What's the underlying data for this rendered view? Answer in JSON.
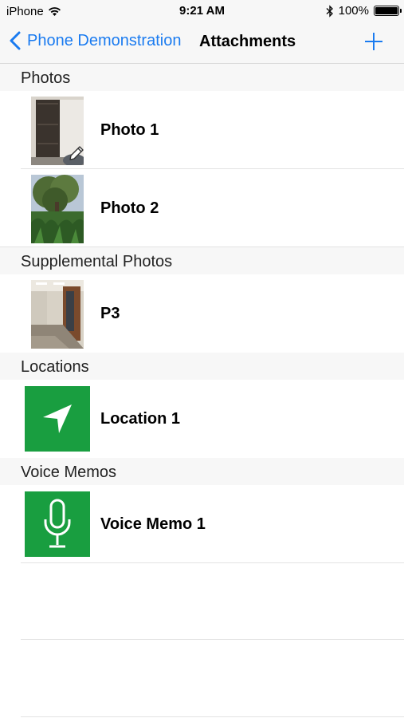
{
  "status_bar": {
    "carrier": "iPhone",
    "time": "9:21 AM",
    "battery": "100%",
    "battery_level": 1.0
  },
  "nav": {
    "back_label": "Phone Demonstration",
    "title": "Attachments",
    "accent_color": "#1a7bf0"
  },
  "sections": {
    "photos": {
      "header": "Photos",
      "items": [
        {
          "label": "Photo 1"
        },
        {
          "label": "Photo 2"
        }
      ]
    },
    "supplemental": {
      "header": "Supplemental Photos",
      "items": [
        {
          "label": "P3"
        }
      ]
    },
    "locations": {
      "header": "Locations",
      "items": [
        {
          "label": "Location 1"
        }
      ]
    },
    "voice_memos": {
      "header": "Voice Memos",
      "items": [
        {
          "label": "Voice Memo 1"
        }
      ]
    }
  },
  "colors": {
    "tile_green": "#199e40",
    "header_bg": "#f7f7f7"
  }
}
